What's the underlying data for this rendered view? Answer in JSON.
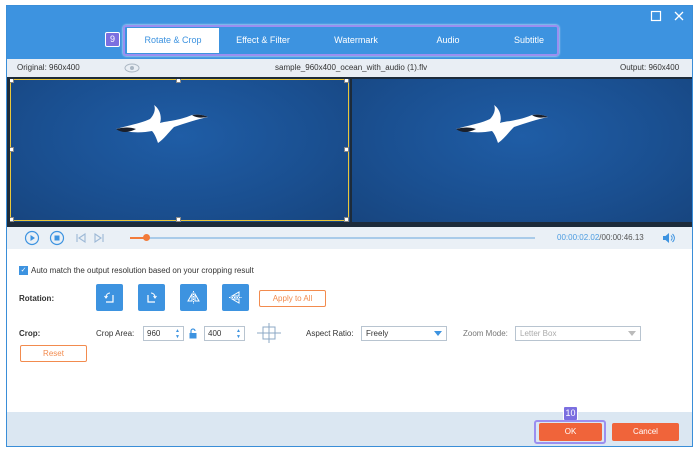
{
  "window": {
    "maximize_icon": "maximize-icon",
    "close_icon": "close-icon"
  },
  "tabs": [
    {
      "label": "Rotate & Crop",
      "active": true
    },
    {
      "label": "Effect & Filter",
      "active": false
    },
    {
      "label": "Watermark",
      "active": false
    },
    {
      "label": "Audio",
      "active": false
    },
    {
      "label": "Subtitle",
      "active": false
    }
  ],
  "badges": {
    "tabs": "9",
    "ok": "10"
  },
  "info": {
    "original": "Original: 960x400",
    "filename": "sample_960x400_ocean_with_audio (1).flv",
    "output": "Output: 960x400"
  },
  "playback": {
    "current": "00:00:02.02",
    "total": "/00:00:46.13",
    "progress": 0.04
  },
  "settings": {
    "auto_match": "Auto match the output resolution based on your cropping result",
    "auto_match_checked": true,
    "rotation_label": "Rotation:",
    "apply_all": "Apply to All",
    "crop_label": "Crop:",
    "crop_area_label": "Crop Area:",
    "crop_width": "960",
    "crop_height": "400",
    "aspect_ratio_label": "Aspect Ratio:",
    "aspect_ratio_value": "Freely",
    "zoom_mode_label": "Zoom Mode:",
    "zoom_mode_value": "Letter Box",
    "reset": "Reset"
  },
  "footer": {
    "ok": "OK",
    "cancel": "Cancel"
  },
  "colors": {
    "accent": "#3d93e0",
    "orange": "#f0643a",
    "highlight": "#9b8ff0"
  }
}
